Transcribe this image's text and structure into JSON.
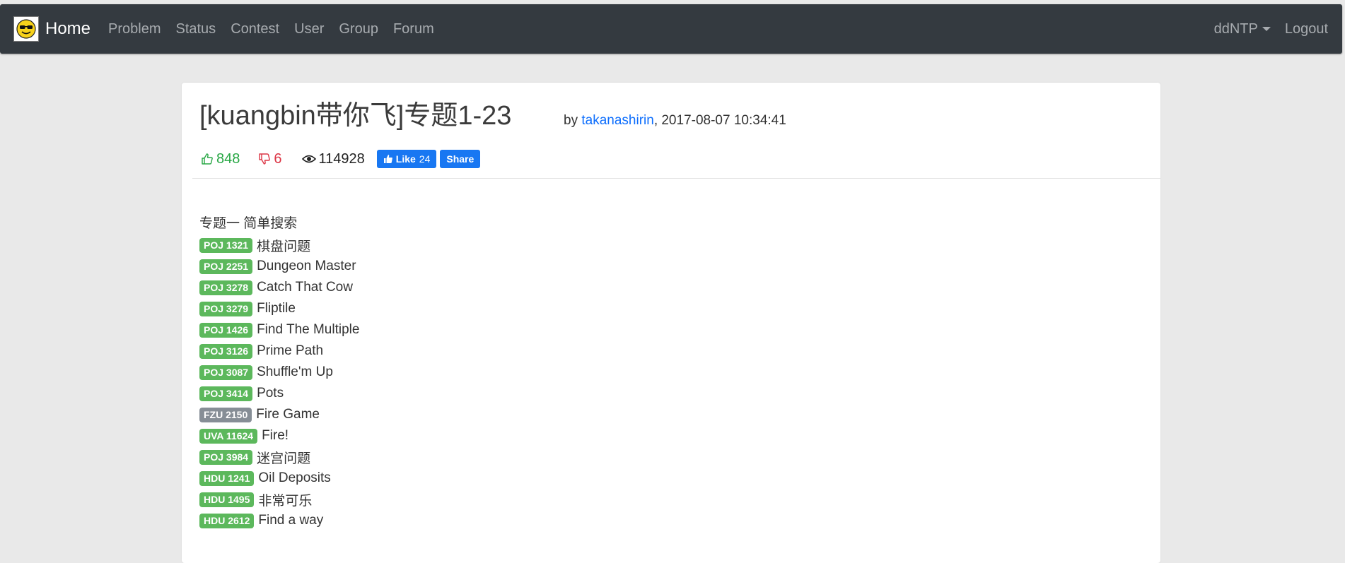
{
  "navbar": {
    "brand": "Home",
    "links": [
      "Problem",
      "Status",
      "Contest",
      "User",
      "Group",
      "Forum"
    ],
    "user": "ddNTP",
    "logout": "Logout"
  },
  "post": {
    "title": "[kuangbin带你飞]专题1-23",
    "by_prefix": "by ",
    "author": "takanashirin",
    "date": ", 2017-08-07 10:34:41",
    "likes": "848",
    "dislikes": "6",
    "views": "114928",
    "fb_like": "Like",
    "fb_like_count": "24",
    "fb_share": "Share"
  },
  "section": {
    "title": "专题一 简单搜索",
    "problems": [
      {
        "id": "POJ 1321",
        "title": "棋盘问题",
        "badge_color": "#5cb85c"
      },
      {
        "id": "POJ 2251",
        "title": "Dungeon Master",
        "badge_color": "#5cb85c"
      },
      {
        "id": "POJ 3278",
        "title": "Catch That Cow",
        "badge_color": "#5cb85c"
      },
      {
        "id": "POJ 3279",
        "title": "Fliptile",
        "badge_color": "#5cb85c"
      },
      {
        "id": "POJ 1426",
        "title": "Find The Multiple",
        "badge_color": "#5cb85c"
      },
      {
        "id": "POJ 3126",
        "title": "Prime Path",
        "badge_color": "#5cb85c"
      },
      {
        "id": "POJ 3087",
        "title": "Shuffle'm Up",
        "badge_color": "#5cb85c"
      },
      {
        "id": "POJ 3414",
        "title": "Pots",
        "badge_color": "#5cb85c"
      },
      {
        "id": "FZU 2150",
        "title": "Fire Game",
        "badge_color": "#868e96"
      },
      {
        "id": "UVA 11624",
        "title": "Fire!",
        "badge_color": "#5cb85c"
      },
      {
        "id": "POJ 3984",
        "title": "迷宫问题",
        "badge_color": "#5cb85c"
      },
      {
        "id": "HDU 1241",
        "title": "Oil Deposits",
        "badge_color": "#5cb85c"
      },
      {
        "id": "HDU 1495",
        "title": "非常可乐",
        "badge_color": "#5cb85c"
      },
      {
        "id": "HDU 2612",
        "title": "Find a way",
        "badge_color": "#5cb85c"
      }
    ]
  },
  "colors": {
    "navbar_bg": "#343a40",
    "link_blue": "#0d6efd",
    "like_green": "#28a745",
    "dislike_red": "#dc3545",
    "facebook_blue": "#1877f2"
  }
}
